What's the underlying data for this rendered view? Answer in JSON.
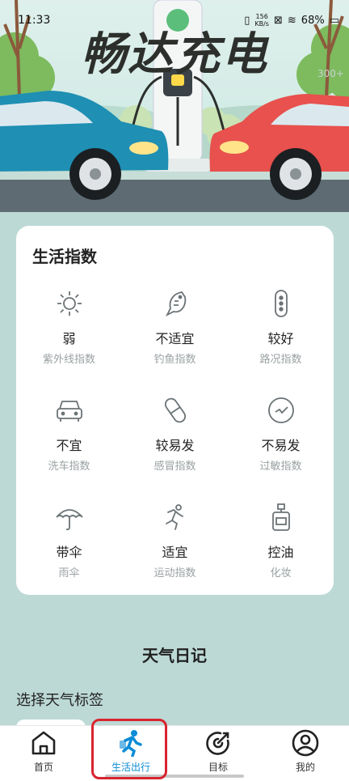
{
  "status": {
    "time": "11:33",
    "net_speed": "156",
    "net_unit": "KB/s",
    "battery": "68%"
  },
  "hero": {
    "title": "畅达充电",
    "watermark": "300+"
  },
  "life_index": {
    "title": "生活指数",
    "items": [
      {
        "value": "弱",
        "label": "紫外线指数",
        "icon": "sun-icon"
      },
      {
        "value": "不适宜",
        "label": "钓鱼指数",
        "icon": "fish-icon"
      },
      {
        "value": "较好",
        "label": "路况指数",
        "icon": "traffic-light-icon"
      },
      {
        "value": "不宜",
        "label": "洗车指数",
        "icon": "car-icon"
      },
      {
        "value": "较易发",
        "label": "感冒指数",
        "icon": "pill-icon"
      },
      {
        "value": "不易发",
        "label": "过敏指数",
        "icon": "check-circle-icon"
      },
      {
        "value": "带伞",
        "label": "雨伞",
        "icon": "umbrella-icon"
      },
      {
        "value": "适宜",
        "label": "运动指数",
        "icon": "running-icon"
      },
      {
        "value": "控油",
        "label": "化妆",
        "icon": "cosmetic-bottle-icon"
      }
    ]
  },
  "weather_diary": {
    "title": "天气日记",
    "tag_title": "选择天气标签"
  },
  "nav": {
    "items": [
      {
        "label": "首页",
        "icon": "home-icon"
      },
      {
        "label": "生活出行",
        "icon": "walk-icon",
        "active": true
      },
      {
        "label": "目标",
        "icon": "target-icon"
      },
      {
        "label": "我的",
        "icon": "user-icon"
      }
    ]
  },
  "colors": {
    "accent": "#0b8bd6",
    "background": "#bcd9d5",
    "highlight": "#d8242f"
  }
}
